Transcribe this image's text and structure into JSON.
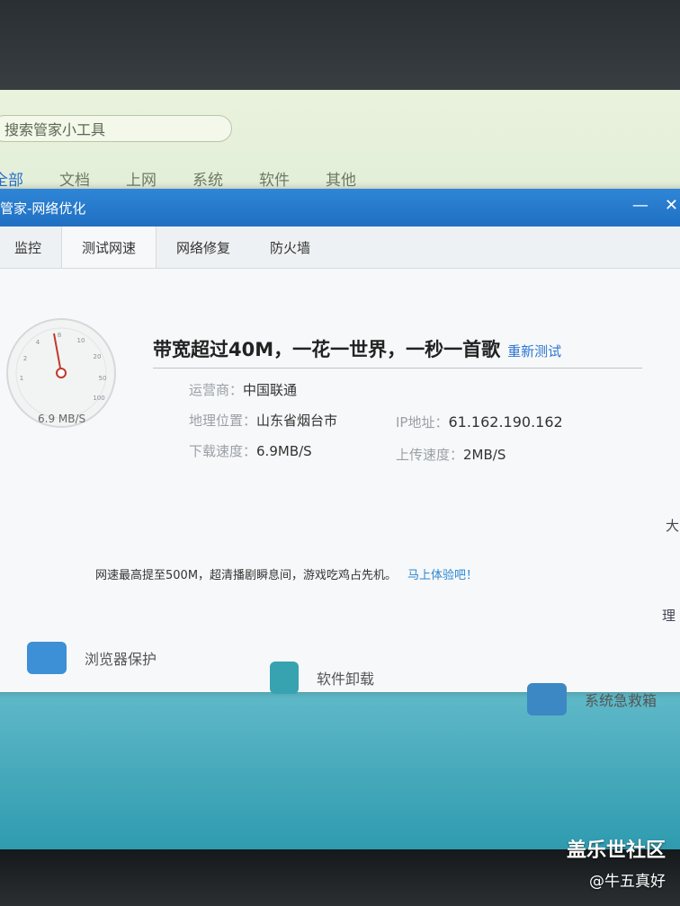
{
  "toolbox": {
    "search_placeholder": "搜索管家小工具",
    "categories": [
      "全部",
      "文档",
      "上网",
      "系统",
      "软件",
      "其他"
    ]
  },
  "window": {
    "title": "管家-网络优化",
    "minimize": "—",
    "close": "✕",
    "tabs": [
      "监控",
      "测试网速",
      "网络修复",
      "防火墙"
    ]
  },
  "speedtest": {
    "gauge_value": "6.9 MB/S",
    "headline": "带宽超过40M，一花一世界，一秒一首歌",
    "retest": "重新测试",
    "isp_label": "运营商：",
    "isp_value": "中国联通",
    "location_label": "地理位置：",
    "location_value": "山东省烟台市",
    "ip_label": "IP地址：",
    "ip_value": "61.162.190.162",
    "download_label": "下载速度：",
    "download_value": "6.9MB/S",
    "upload_label": "上传速度：",
    "upload_value": "2MB/S",
    "promo_text": "网速最高提至500M，超清播剧瞬息间，游戏吃鸡占先机。",
    "promo_link": "马上体验吧！"
  },
  "bottom_tools": [
    "浏览器保护",
    "软件卸载",
    "系统急救箱"
  ],
  "side_chars": [
    "大",
    "理"
  ],
  "watermark": {
    "line1": "盖乐世社区",
    "line2": "@牛五真好"
  },
  "colors": {
    "titlebar": "#1f6fc2",
    "link": "#2a76d2"
  }
}
